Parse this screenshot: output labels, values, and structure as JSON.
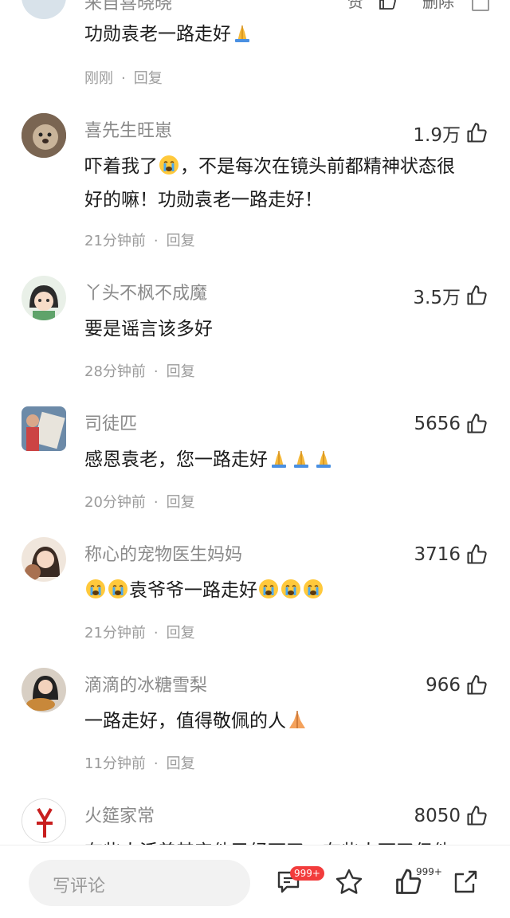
{
  "top": {
    "partial_username": "来自喜晓晓",
    "like_label": "赞",
    "delete_label": "删除"
  },
  "first_comment": {
    "text": "功勋袁老一路走好",
    "time": "刚刚",
    "reply": "回复"
  },
  "comments": [
    {
      "username": "喜先生旺崽",
      "likes": "1.9万",
      "line1": "吓着我了",
      "line1b": "，不是每次在镜头前都精神状态很",
      "line2": "好的嘛！功勋袁老一路走好！",
      "time": "21分钟前",
      "reply": "回复"
    },
    {
      "username": "丫头不枫不成魔",
      "likes": "3.5万",
      "text": "要是谣言该多好",
      "time": "28分钟前",
      "reply": "回复"
    },
    {
      "username": "司徒匹",
      "likes": "5656",
      "text": "感恩袁老，您一路走好",
      "time": "20分钟前",
      "reply": "回复"
    },
    {
      "username": "称心的宠物医生妈妈",
      "likes": "3716",
      "text": "袁爷爷一路走好",
      "time": "21分钟前",
      "reply": "回复"
    },
    {
      "username": "滴滴的冰糖雪梨",
      "likes": "966",
      "text": "一路走好，值得敬佩的人",
      "time": "11分钟前",
      "reply": "回复"
    },
    {
      "username": "火筵家常",
      "likes": "8050",
      "text": "有些人活着其实他已经死了，有些人死了但他"
    }
  ],
  "dot": "·",
  "bottom": {
    "placeholder": "写评论",
    "comment_badge": "999+",
    "like_badge": "999+"
  },
  "colors": {
    "accent_red": "#f23c3c",
    "muted": "#9b9b9b"
  }
}
